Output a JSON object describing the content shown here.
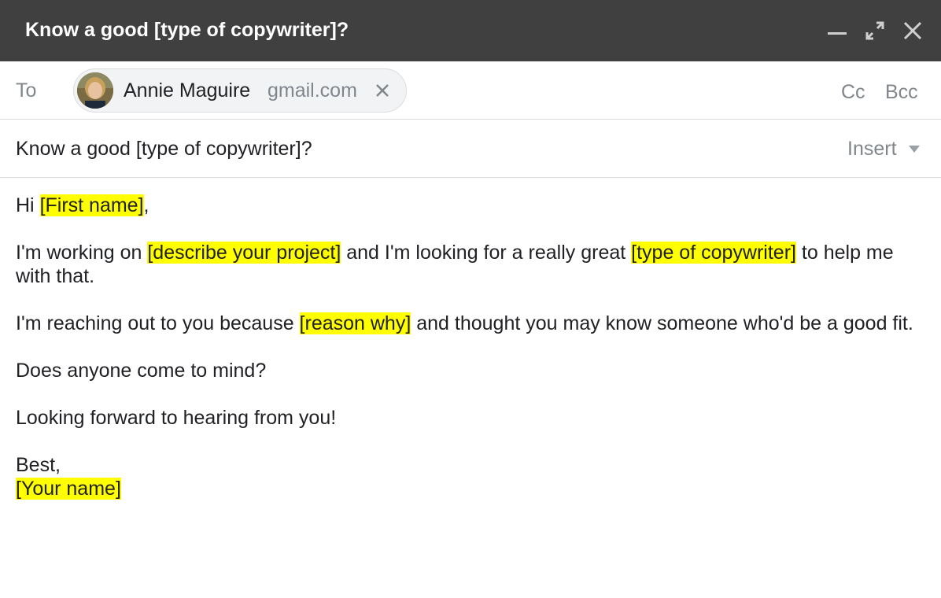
{
  "window": {
    "title": "Know a good [type of copywriter]?",
    "controls": [
      "minimize-icon",
      "expand-icon",
      "close-icon"
    ]
  },
  "to_row": {
    "label": "To",
    "recipient": {
      "name": "Annie Maguire",
      "domain": "gmail.com"
    },
    "cc_label": "Cc",
    "bcc_label": "Bcc"
  },
  "subject_row": {
    "subject": "Know a good [type of copywriter]?",
    "insert_label": "Insert"
  },
  "body": {
    "greeting_prefix": "Hi ",
    "greeting_placeholder": "[First name]",
    "greeting_suffix": ",",
    "p1_a": "I'm working on ",
    "p1_placeholder1": "[describe your project]",
    "p1_b": " and I'm looking for a really great ",
    "p1_placeholder2": "[type of copywriter]",
    "p1_c": " to help me with that.",
    "p2_a": "I'm reaching out to you because ",
    "p2_placeholder": "[reason why]",
    "p2_b": " and thought you may know someone who'd be a good fit.",
    "p3": "Does anyone come to mind?",
    "p4": "Looking forward to hearing from you!",
    "signoff": "Best,",
    "signature_placeholder": "[Your name]"
  },
  "colors": {
    "titlebar_bg": "#404040",
    "highlight": "#ffff00",
    "muted_text": "#80868b",
    "body_text": "#202124"
  }
}
